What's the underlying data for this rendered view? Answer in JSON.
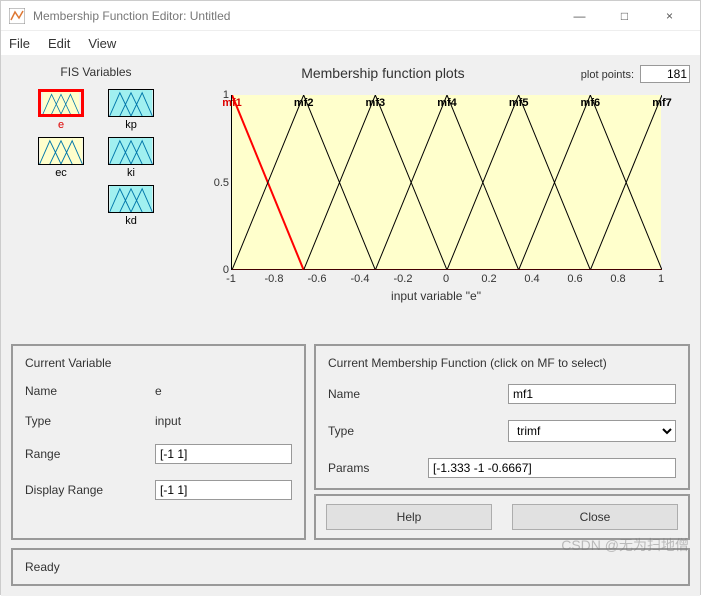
{
  "window": {
    "title": "Membership Function Editor: Untitled",
    "minimize": "—",
    "maximize": "□",
    "close": "×"
  },
  "menu": {
    "file": "File",
    "edit": "Edit",
    "view": "View"
  },
  "fis": {
    "title": "FIS Variables",
    "vars": [
      {
        "name": "e",
        "type": "input",
        "selected": true
      },
      {
        "name": "kp",
        "type": "output",
        "selected": false
      },
      {
        "name": "ec",
        "type": "input",
        "selected": false
      },
      {
        "name": "ki",
        "type": "output",
        "selected": false
      },
      {
        "name": "",
        "type": "none",
        "selected": false
      },
      {
        "name": "kd",
        "type": "output",
        "selected": false
      }
    ]
  },
  "plot": {
    "title": "Membership function plots",
    "plot_points_label": "plot points:",
    "plot_points": "181",
    "xlabel": "input variable \"e\"",
    "yticks": [
      "0",
      "0.5",
      "1"
    ],
    "xticks": [
      "-1",
      "-0.8",
      "-0.6",
      "-0.4",
      "-0.2",
      "0",
      "0.2",
      "0.4",
      "0.6",
      "0.8",
      "1"
    ],
    "mfs": [
      "mf1",
      "mf2",
      "mf3",
      "mf4",
      "mf5",
      "mf6",
      "mf7"
    ]
  },
  "currentVar": {
    "title": "Current Variable",
    "name_label": "Name",
    "name": "e",
    "type_label": "Type",
    "type": "input",
    "range_label": "Range",
    "range": "[-1 1]",
    "drange_label": "Display Range",
    "drange": "[-1 1]"
  },
  "currentMF": {
    "title": "Current Membership Function (click on MF to select)",
    "name_label": "Name",
    "name": "mf1",
    "type_label": "Type",
    "type": "trimf",
    "params_label": "Params",
    "params": "[-1.333 -1 -0.6667]",
    "help": "Help",
    "close": "Close"
  },
  "status": "Ready",
  "watermark": "CSDN @无为扫地僧",
  "chart_data": {
    "type": "line",
    "title": "Membership function plots",
    "xlabel": "input variable \"e\"",
    "ylabel": "",
    "xlim": [
      -1,
      1
    ],
    "ylim": [
      0,
      1
    ],
    "x": [
      -1,
      -0.6667,
      -0.3333,
      0,
      0.3333,
      0.6667,
      1
    ],
    "series": [
      {
        "name": "mf1",
        "type": "trimf",
        "params": [
          -1.333,
          -1,
          -0.6667
        ],
        "selected": true
      },
      {
        "name": "mf2",
        "type": "trimf",
        "params": [
          -1,
          -0.6667,
          -0.3333
        ]
      },
      {
        "name": "mf3",
        "type": "trimf",
        "params": [
          -0.6667,
          -0.3333,
          0
        ]
      },
      {
        "name": "mf4",
        "type": "trimf",
        "params": [
          -0.3333,
          0,
          0.3333
        ]
      },
      {
        "name": "mf5",
        "type": "trimf",
        "params": [
          0,
          0.3333,
          0.6667
        ]
      },
      {
        "name": "mf6",
        "type": "trimf",
        "params": [
          0.3333,
          0.6667,
          1
        ]
      },
      {
        "name": "mf7",
        "type": "trimf",
        "params": [
          0.6667,
          1,
          1.333
        ]
      }
    ]
  }
}
